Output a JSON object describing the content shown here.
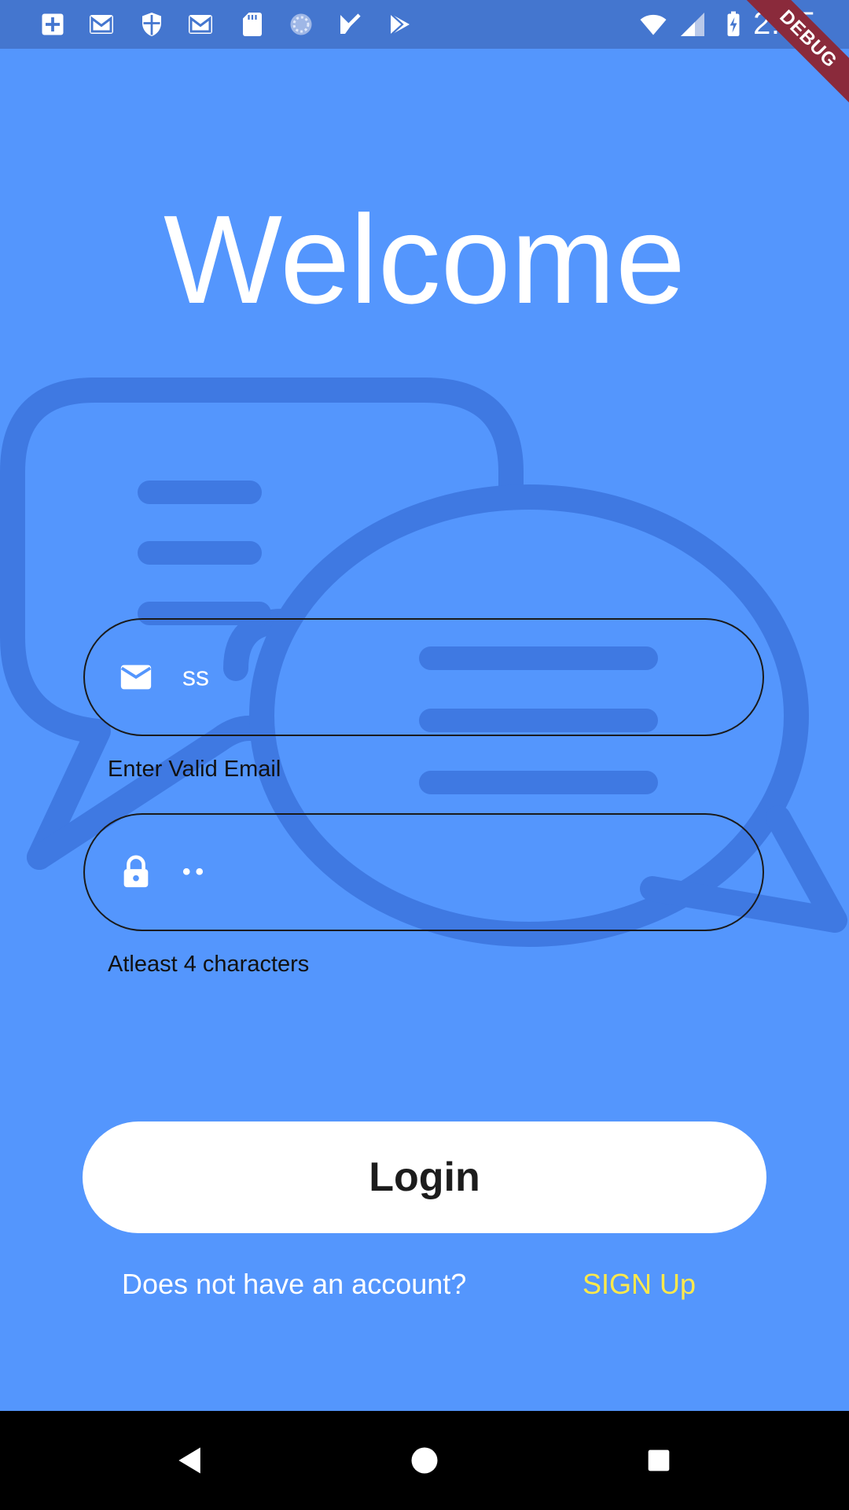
{
  "status_bar": {
    "time": "2:05",
    "left_icons": [
      "plus-box-icon",
      "gmail-icon",
      "shield-icon",
      "gmail-icon",
      "sd-card-icon",
      "sync-circle-icon",
      "check-flag-icon",
      "play-store-icon"
    ],
    "right_icons": [
      "wifi-icon",
      "cell-signal-icon",
      "battery-charging-icon"
    ]
  },
  "debug_banner": "DEBUG",
  "welcome": {
    "title": "Welcome"
  },
  "email": {
    "icon": "mail-icon",
    "value": "ss",
    "helper": "Enter Valid Email"
  },
  "password": {
    "icon": "lock-icon",
    "value": "••",
    "helper": "Atleast 4 characters"
  },
  "login": {
    "label": "Login"
  },
  "signup": {
    "prompt": "Does not have an account?",
    "link": "SIGN Up"
  },
  "colors": {
    "background": "#5496fd",
    "status_bar": "#4476cf",
    "illustration": "#3f79e2",
    "signup_link": "#ffe94a",
    "debug_banner": "#8a2a3b"
  },
  "nav_bar": {
    "icons": [
      "back-triangle-icon",
      "home-circle-icon",
      "recents-square-icon"
    ]
  }
}
